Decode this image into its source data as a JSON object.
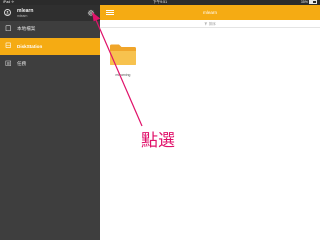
{
  "status_bar": {
    "carrier": "iPad ✈",
    "time": "下午9:51",
    "battery": "35%"
  },
  "sidebar": {
    "account": {
      "name": "mlearn",
      "subtitle": "mlearn"
    },
    "items": [
      {
        "label": "本地檔案",
        "icon": "phone-icon",
        "active": false
      },
      {
        "label": "DiskStation",
        "icon": "nas-icon",
        "active": true
      },
      {
        "label": "任務",
        "icon": "tasks-icon",
        "active": false
      }
    ]
  },
  "header": {
    "title": "mlearn",
    "filter_label": "排序"
  },
  "files": [
    {
      "name": "mlearning",
      "type": "folder"
    }
  ],
  "annotation": {
    "text": "點選"
  },
  "colors": {
    "accent": "#f5ab13",
    "sidebar_bg": "#3e3e3e",
    "sidebar_header_bg": "#2f2f2f",
    "annotation": "#e0126a"
  }
}
